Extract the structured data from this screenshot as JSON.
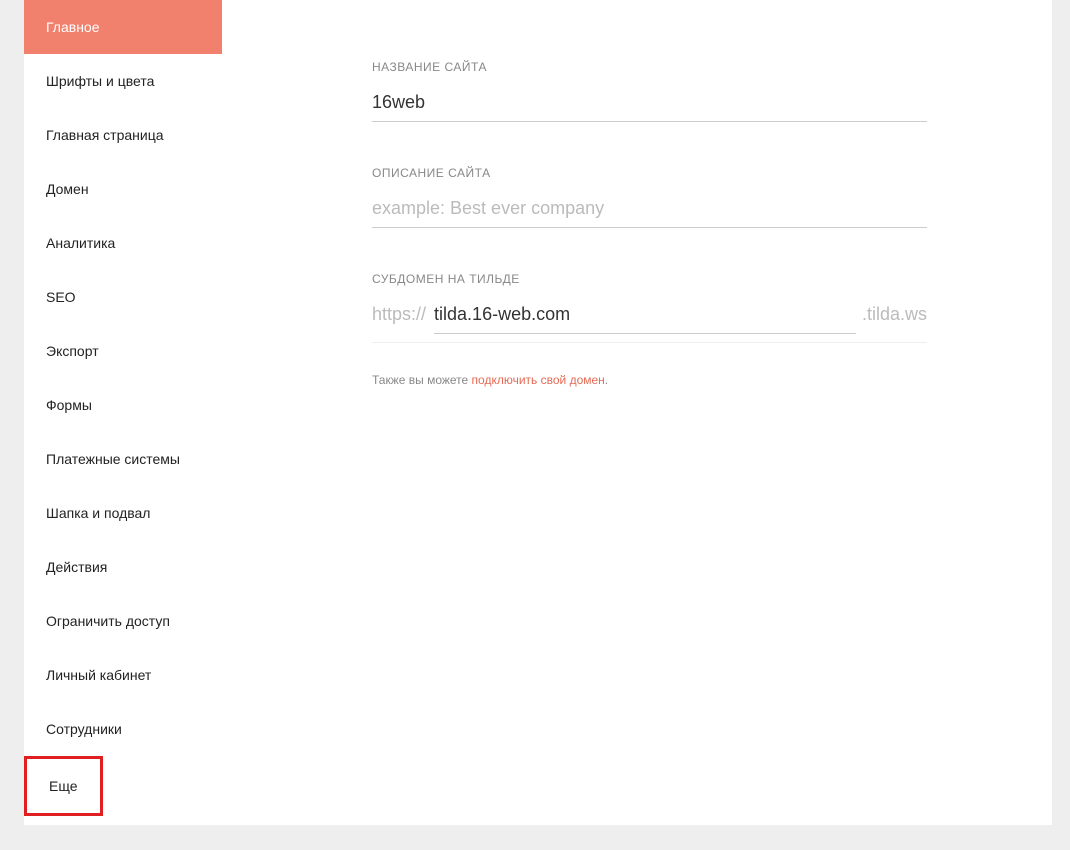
{
  "sidebar": {
    "items": [
      {
        "label": "Главное",
        "active": true
      },
      {
        "label": "Шрифты и цвета",
        "active": false
      },
      {
        "label": "Главная страница",
        "active": false
      },
      {
        "label": "Домен",
        "active": false
      },
      {
        "label": "Аналитика",
        "active": false
      },
      {
        "label": "SEO",
        "active": false
      },
      {
        "label": "Экспорт",
        "active": false
      },
      {
        "label": "Формы",
        "active": false
      },
      {
        "label": "Платежные системы",
        "active": false
      },
      {
        "label": "Шапка и подвал",
        "active": false
      },
      {
        "label": "Действия",
        "active": false
      },
      {
        "label": "Ограничить доступ",
        "active": false
      },
      {
        "label": "Личный кабинет",
        "active": false
      },
      {
        "label": "Сотрудники",
        "active": false
      },
      {
        "label": "Еще",
        "active": false
      }
    ]
  },
  "fields": {
    "site_name": {
      "label": "НАЗВАНИЕ САЙТА",
      "value": "16web"
    },
    "site_description": {
      "label": "ОПИСАНИЕ САЙТА",
      "placeholder": "example: Best ever company",
      "value": ""
    },
    "subdomain": {
      "label": "СУБДОМЕН НА ТИЛЬДЕ",
      "prefix": "https://",
      "value": "tilda.16-web.com",
      "suffix": ".tilda.ws"
    }
  },
  "hint": {
    "text": "Также вы можете ",
    "link_text": "подключить свой домен",
    "period": "."
  }
}
